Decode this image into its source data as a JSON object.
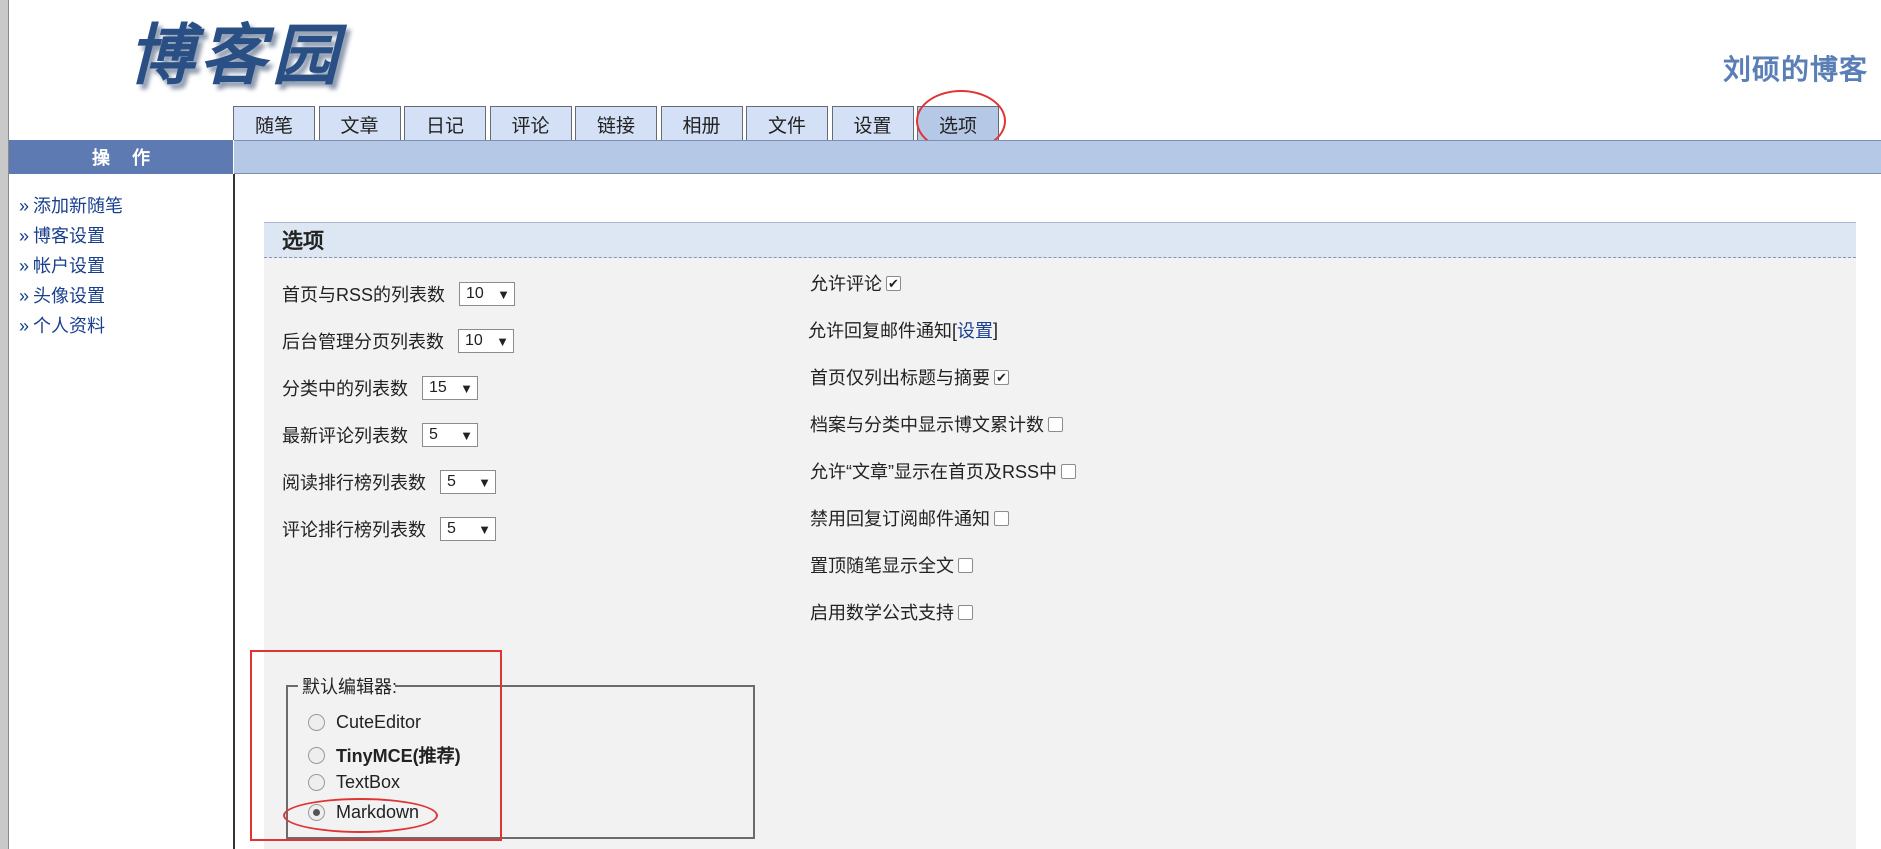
{
  "header": {
    "logo_text": "博客园",
    "blog_title": "刘硕的博客"
  },
  "tabs": [
    {
      "label": "随笔"
    },
    {
      "label": "文章"
    },
    {
      "label": "日记"
    },
    {
      "label": "评论"
    },
    {
      "label": "链接"
    },
    {
      "label": "相册"
    },
    {
      "label": "文件"
    },
    {
      "label": "设置"
    },
    {
      "label": "选项",
      "active": true
    }
  ],
  "sidebar": {
    "title": "操作",
    "arrow": "»",
    "links": [
      "添加新随笔",
      "博客设置",
      "帐户设置",
      "头像设置",
      "个人资料"
    ]
  },
  "options": {
    "title": "选项",
    "left": [
      {
        "label": "首页与RSS的列表数",
        "value": "10"
      },
      {
        "label": "后台管理分页列表数",
        "value": "10"
      },
      {
        "label": "分类中的列表数",
        "value": "15"
      },
      {
        "label": "最新评论列表数",
        "value": "5"
      },
      {
        "label": "阅读排行榜列表数",
        "value": "5"
      },
      {
        "label": "评论排行榜列表数",
        "value": "5"
      }
    ],
    "right": {
      "allow_comment": {
        "label": "允许评论",
        "checked": true
      },
      "reply_mail": {
        "label": "允许回复邮件通知[",
        "link": "设置",
        "suffix": "]"
      },
      "home_summary": {
        "label": "首页仅列出标题与摘要",
        "checked": true
      },
      "archive_count": {
        "label": "档案与分类中显示博文累计数",
        "checked": false
      },
      "article_home": {
        "label": "允许“文章”显示在首页及RSS中",
        "checked": false
      },
      "disable_sub_mail": {
        "label": "禁用回复订阅邮件通知",
        "checked": false
      },
      "top_full": {
        "label": "置顶随笔显示全文",
        "checked": false
      },
      "math": {
        "label": "启用数学公式支持",
        "checked": false
      }
    }
  },
  "editor": {
    "legend": "默认编辑器:",
    "options": [
      {
        "label": "CuteEditor",
        "selected": false
      },
      {
        "label": "TinyMCE(推荐)",
        "selected": false
      },
      {
        "label": "TextBox",
        "selected": false
      },
      {
        "label": "Markdown",
        "selected": true
      }
    ]
  },
  "glyphs": {
    "caret": "▼",
    "check": "✔"
  }
}
